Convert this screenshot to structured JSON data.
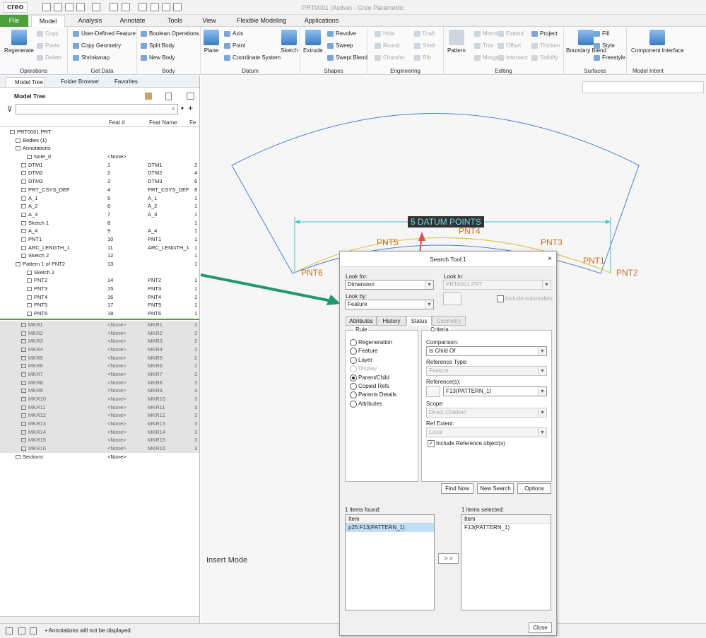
{
  "app": {
    "logo": "creo",
    "window_title": "PRT0001 (Active) - Creo Parametric"
  },
  "tabs": [
    "File",
    "Model",
    "Analysis",
    "Annotate",
    "Tools",
    "View",
    "Flexible Modeling",
    "Applications"
  ],
  "ribbon": {
    "operations": {
      "regenerate": "Regenerate",
      "copy": "Copy",
      "paste": "Paste",
      "delete": "Delete",
      "label": "Operations"
    },
    "get_data": {
      "udf": "User-Defined Feature",
      "copy_geometry": "Copy Geometry",
      "shrinkwrap": "Shrinkwrap",
      "label": "Get Data"
    },
    "body": {
      "boolean": "Boolean Operations",
      "split": "Split Body",
      "new_body": "New Body",
      "label": "Body"
    },
    "datum": {
      "plane": "Plane",
      "axis": "Axis",
      "point": "Point",
      "csys": "Coordinate System",
      "sketch": "Sketch",
      "label": "Datum"
    },
    "shapes": {
      "extrude": "Extrude",
      "revolve": "Revolve",
      "sweep": "Sweep",
      "swept_blend": "Swept Blend",
      "label": "Shapes"
    },
    "engineering": {
      "hole": "Hole",
      "round": "Round",
      "chamfer": "Chamfer",
      "draft": "Draft",
      "shell": "Shell",
      "rib": "Rib",
      "label": "Engineering"
    },
    "editing": {
      "pattern": "Pattern",
      "mirror": "Mirror",
      "trim": "Trim",
      "merge": "Merge",
      "extend": "Extend",
      "offset": "Offset",
      "intersect": "Intersect",
      "project": "Project",
      "thicken": "Thicken",
      "solidify": "Solidify",
      "label": "Editing"
    },
    "surfaces": {
      "boundary_blend": "Boundary Blend",
      "fill": "Fill",
      "style": "Style",
      "freestyle": "Freestyle",
      "label": "Surfaces"
    },
    "model_intent": {
      "component_interface": "Component Interface",
      "label": "Model Intent"
    }
  },
  "left_panel": {
    "tabs": [
      "Model Tree",
      "Folder Browser",
      "Favorites"
    ],
    "title": "Model Tree",
    "columns": [
      "Feat #",
      "Feat Name",
      "Fe"
    ],
    "rows": [
      {
        "name": "PRT0001.PRT",
        "num": "",
        "fname": "",
        "x": "",
        "indent": 0,
        "grey": false
      },
      {
        "name": "Bodies (1)",
        "num": "",
        "fname": "",
        "x": "",
        "indent": 1,
        "grey": false
      },
      {
        "name": "Annotations",
        "num": "",
        "fname": "",
        "x": "",
        "indent": 1,
        "grey": false
      },
      {
        "name": "Note_0",
        "num": "<None>",
        "fname": "",
        "x": "",
        "indent": 3,
        "grey": false
      },
      {
        "name": "DTM1",
        "num": "1",
        "fname": "DTM1",
        "x": "2",
        "indent": 2,
        "grey": false
      },
      {
        "name": "DTM2",
        "num": "2",
        "fname": "DTM2",
        "x": "4",
        "indent": 2,
        "grey": false
      },
      {
        "name": "DTM3",
        "num": "3",
        "fname": "DTM3",
        "x": "6",
        "indent": 2,
        "grey": false
      },
      {
        "name": "PRT_CSYS_DEF",
        "num": "4",
        "fname": "PRT_CSYS_DEF",
        "x": "8",
        "indent": 2,
        "grey": false
      },
      {
        "name": "A_1",
        "num": "5",
        "fname": "A_1",
        "x": "1",
        "indent": 2,
        "grey": false
      },
      {
        "name": "A_2",
        "num": "6",
        "fname": "A_2",
        "x": "1",
        "indent": 2,
        "grey": false
      },
      {
        "name": "A_3",
        "num": "7",
        "fname": "A_3",
        "x": "1",
        "indent": 2,
        "grey": false
      },
      {
        "name": "Sketch 1",
        "num": "8",
        "fname": "",
        "x": "1",
        "indent": 2,
        "grey": false
      },
      {
        "name": "A_4",
        "num": "9",
        "fname": "A_4",
        "x": "1",
        "indent": 2,
        "grey": false
      },
      {
        "name": "PNT1",
        "num": "10",
        "fname": "PNT1",
        "x": "1",
        "indent": 2,
        "grey": false
      },
      {
        "name": "ARC_LENGTH_1",
        "num": "11",
        "fname": "ARC_LENGTH_1",
        "x": "1",
        "indent": 2,
        "grey": false
      },
      {
        "name": "Sketch 2",
        "num": "12",
        "fname": "",
        "x": "1",
        "indent": 2,
        "grey": false
      },
      {
        "name": "Pattern 1 of PNT2",
        "num": "13",
        "fname": "",
        "x": "1",
        "indent": 1,
        "grey": false
      },
      {
        "name": "Sketch 2",
        "num": "",
        "fname": "",
        "x": "",
        "indent": 3,
        "grey": false
      },
      {
        "name": "PNT2",
        "num": "14",
        "fname": "PNT2",
        "x": "1",
        "indent": 3,
        "grey": false
      },
      {
        "name": "PNT3",
        "num": "15",
        "fname": "PNT3",
        "x": "1",
        "indent": 3,
        "grey": false
      },
      {
        "name": "PNT4",
        "num": "16",
        "fname": "PNT4",
        "x": "1",
        "indent": 3,
        "grey": false
      },
      {
        "name": "PNT5",
        "num": "17",
        "fname": "PNT5",
        "x": "1",
        "indent": 3,
        "grey": false
      },
      {
        "name": "PNT6",
        "num": "18",
        "fname": "PNT6",
        "x": "1",
        "indent": 3,
        "grey": false
      },
      {
        "name": "SEP",
        "num": "",
        "fname": "",
        "x": "",
        "indent": 0,
        "grey": false
      },
      {
        "name": "MKR1",
        "num": "<None>",
        "fname": "MKR1",
        "x": "2",
        "indent": 2,
        "grey": true
      },
      {
        "name": "MKR2",
        "num": "<None>",
        "fname": "MKR2",
        "x": "2",
        "indent": 2,
        "grey": true
      },
      {
        "name": "MKR3",
        "num": "<None>",
        "fname": "MKR3",
        "x": "2",
        "indent": 2,
        "grey": true
      },
      {
        "name": "MKR4",
        "num": "<None>",
        "fname": "MKR4",
        "x": "2",
        "indent": 2,
        "grey": true
      },
      {
        "name": "MKR5",
        "num": "<None>",
        "fname": "MKR5",
        "x": "2",
        "indent": 2,
        "grey": true
      },
      {
        "name": "MKR6",
        "num": "<None>",
        "fname": "MKR6",
        "x": "2",
        "indent": 2,
        "grey": true
      },
      {
        "name": "MKR7",
        "num": "<None>",
        "fname": "MKR7",
        "x": "2",
        "indent": 2,
        "grey": true
      },
      {
        "name": "MKR8",
        "num": "<None>",
        "fname": "MKR8",
        "x": "3",
        "indent": 2,
        "grey": true
      },
      {
        "name": "MKR9",
        "num": "<None>",
        "fname": "MKR9",
        "x": "3",
        "indent": 2,
        "grey": true
      },
      {
        "name": "MKR10",
        "num": "<None>",
        "fname": "MKR10",
        "x": "3",
        "indent": 2,
        "grey": true
      },
      {
        "name": "MKR11",
        "num": "<None>",
        "fname": "MKR11",
        "x": "3",
        "indent": 2,
        "grey": true
      },
      {
        "name": "MKR12",
        "num": "<None>",
        "fname": "MKR12",
        "x": "3",
        "indent": 2,
        "grey": true
      },
      {
        "name": "MKR13",
        "num": "<None>",
        "fname": "MKR13",
        "x": "3",
        "indent": 2,
        "grey": true
      },
      {
        "name": "MKR14",
        "num": "<None>",
        "fname": "MKR14",
        "x": "3",
        "indent": 2,
        "grey": true
      },
      {
        "name": "MKR15",
        "num": "<None>",
        "fname": "MKR15",
        "x": "3",
        "indent": 2,
        "grey": true
      },
      {
        "name": "MKR16",
        "num": "<None>",
        "fname": "MKR16",
        "x": "3",
        "indent": 2,
        "grey": true
      },
      {
        "name": "Sections",
        "num": "<None>",
        "fname": "",
        "x": "",
        "indent": 1,
        "grey": false
      }
    ]
  },
  "status": {
    "message": "Annotations will not be displayed."
  },
  "viewport": {
    "mode": "Insert Mode",
    "dimension_label": "5 DATUM POINTS",
    "points": [
      "PNT1",
      "PNT2",
      "PNT3",
      "PNT4",
      "PNT5",
      "PNT6"
    ]
  },
  "dialog": {
    "title": "Search Tool:1",
    "look_for_label": "Look for:",
    "look_for": "Dimension",
    "look_in_label": "Look in:",
    "look_in": "PRT0001.PRT",
    "look_by_label": "Look by:",
    "look_by": "Feature",
    "include_submodels": "Include submodels",
    "tabs": [
      "Attributes",
      "History",
      "Status",
      "Geometry"
    ],
    "rule_title": "Rule",
    "rules": [
      "Regeneration",
      "Feature",
      "Layer",
      "Display",
      "Parent/Child",
      "Copied Refs",
      "Parents Details",
      "Attributes"
    ],
    "criteria_title": "Criteria",
    "comparison_label": "Comparison:",
    "comparison": "Is Child Of",
    "reference_type_label": "Reference Type:",
    "reference_type": "Feature",
    "references_label": "Reference(s):",
    "references": "F13(PATTERN_1)",
    "scope_label": "Scope:",
    "scope": "Direct Children",
    "ref_extent_label": "Ref Extent:",
    "ref_extent": "Local",
    "include_ref": "Include Reference object(s)",
    "find_now": "Find Now",
    "new_search": "New Search",
    "options": "Options",
    "found_label": "1 items found:",
    "selected_label": "1 items selected:",
    "item_header": "Item",
    "found_item": "p25:F13(PATTERN_1)",
    "selected_item": "F13(PATTERN_1)",
    "move_button": "> >",
    "close": "Close"
  },
  "colors": {
    "green": "#4ea03c",
    "arrow_green": "#1f9a6e",
    "arrow_red": "#e24b4b",
    "arc_blue": "#4a7fd6",
    "point_orange": "#c86d1c",
    "dim_cyan": "#3fc6cf"
  }
}
